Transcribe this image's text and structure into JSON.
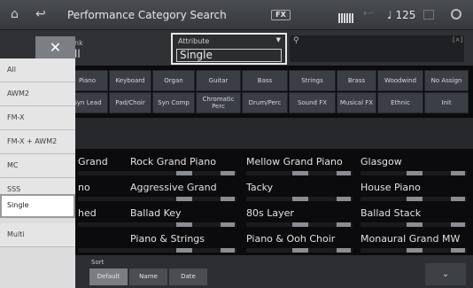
{
  "header": {
    "home_icon": "home-icon",
    "back_icon": "return-arrow-icon",
    "title": "Performance Category Search",
    "fx_label": "FX",
    "tempo": "♩ 125"
  },
  "filter": {
    "bank_label": "nk",
    "bank_value": "ll",
    "attribute_label": "Attribute",
    "attribute_value": "Single",
    "search_icon": "search-icon"
  },
  "categories": [
    "Piano",
    "Keyboard",
    "Organ",
    "Guitar",
    "Bass",
    "Strings",
    "Brass",
    "Woodwind",
    "No Assign",
    "Syn Lead",
    "Pad/Choir",
    "Syn Comp",
    "Chromatic Perc",
    "Drum/Perc",
    "Sound FX",
    "Musical FX",
    "Ethnic",
    "Init"
  ],
  "results": [
    [
      "Grand",
      "Rock Grand Piano",
      "Mellow Grand Piano",
      "Glasgow"
    ],
    [
      "no",
      "Aggressive Grand",
      "Tacky",
      "House Piano"
    ],
    [
      "hed",
      "Ballad Key",
      "80s Layer",
      "Ballad Stack"
    ],
    [
      "",
      "Piano & Strings",
      "Piano & Ooh Choir",
      "Monaural Grand MW"
    ]
  ],
  "sort": {
    "label": "Sort",
    "buttons": [
      "Default",
      "Name",
      "Date"
    ],
    "more_icon": "chevron-down-icon"
  },
  "dropdown": {
    "close_label": "✕",
    "items": [
      "All",
      "AWM2",
      "FM-X",
      "FM-X + AWM2",
      "MC",
      "SSS",
      "Single",
      "Multi"
    ],
    "selected": "Single"
  }
}
